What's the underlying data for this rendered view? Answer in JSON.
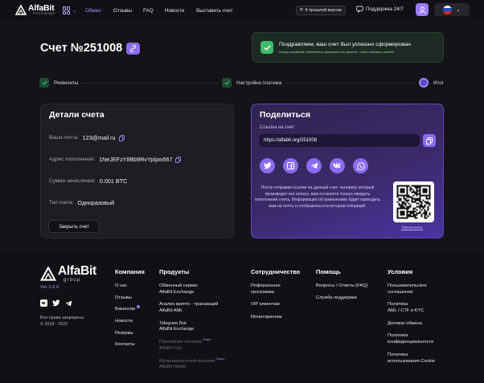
{
  "header": {
    "logo": {
      "title": "AlfaBit",
      "sub": "exchange"
    },
    "nav": [
      "Обмен",
      "Отзывы",
      "FAQ",
      "Новости",
      "Выставить счет"
    ],
    "old_version": "К прошлой версии",
    "support": "Поддержка 24/7",
    "flag_colors": [
      "#ffffff",
      "#1e4ec6",
      "#d52b1e"
    ]
  },
  "page": {
    "title": "Счет №251008"
  },
  "notice": {
    "title": "Поздравляем, ваш счет был успешно сформирован",
    "sub": "Перед отправкой, обязательно проверьте все данные, чтобы избежать ошибок"
  },
  "steps": [
    {
      "label": "Реквизиты",
      "state": "done"
    },
    {
      "label": "Настройка платежа",
      "state": "done"
    },
    {
      "label": "Итог",
      "state": "current"
    }
  ],
  "details": {
    "title": "Детали счета",
    "rows": [
      {
        "label": "Ваша почта:",
        "value": "123@mail.ru"
      },
      {
        "label": "Адрес пополнения:",
        "value": "1NeJEFzY8Bb9RvYpIjav567"
      },
      {
        "label": "Сумма зачисления:",
        "value": "0.001 BTC"
      },
      {
        "label": "Тип счета:",
        "value": "Одноразовый"
      }
    ],
    "close_button": "Закрыть счет"
  },
  "share": {
    "title": "Поделиться",
    "link_label": "Ссылка на счет",
    "link": "https://alfabit.org/251008",
    "socials": [
      {
        "name": "twitter-icon",
        "glyph": "t"
      },
      {
        "name": "facebook-icon",
        "glyph": "f"
      },
      {
        "name": "telegram-icon",
        "glyph": "➤"
      },
      {
        "name": "vk-icon",
        "glyph": "vk"
      },
      {
        "name": "whatsapp-icon",
        "glyph": "✆"
      }
    ],
    "info": "После отправки ссылки на данный счет, человеку который производит его оплату, вам останется только ожидать пополнения счета. Информация об изменениях будет приходить вам на почту и отображаться в истории операций.",
    "enlarge": "Увеличить"
  },
  "footer": {
    "logo": {
      "title": "AlfaBit",
      "sub": "group"
    },
    "version": "Ver 1.0.0",
    "rights": "Все права защищены.",
    "years": "© 2018 - 2022",
    "columns": {
      "company": {
        "title": "Компания",
        "links": [
          "О нас",
          "Отзывы",
          "Вакансии",
          "Новости",
          "Резервы",
          "Контакты"
        ]
      },
      "products": {
        "title": "Продукты",
        "links": [
          {
            "l1": "Обменный сервис",
            "l2": "AlfaBit Exchange"
          },
          {
            "l1": "Анализ крипто - транзакций",
            "l2": "AlfaBit AML"
          },
          {
            "l1": "Telegram Bot",
            "l2": "AlfaBit Exchange"
          },
          {
            "l1": "Платежная система",
            "l2": "AlfaBit Pay",
            "soon": "Скоро"
          },
          {
            "l1": "Мультивалютный кошелек",
            "l2": "AlfaBit Wallet",
            "soon": "Скоро"
          }
        ]
      },
      "cooperation": {
        "title": "Сотрудничество",
        "links": [
          {
            "l1": "Реферальная",
            "l2": "программа"
          },
          {
            "l1": "VIP клиентам"
          },
          {
            "l1": "Мониторингам"
          }
        ]
      },
      "help": {
        "title": "Помощь",
        "links": [
          "Вопросы / Ответы (FAQ)",
          "Служба поддержки"
        ]
      },
      "terms": {
        "title": "Условия",
        "links": [
          {
            "l1": "Пользовательское",
            "l2": "соглашение"
          },
          {
            "l1": "Политика",
            "l2": "AML / CTF и KYC"
          },
          {
            "l1": "Договор обмена"
          },
          {
            "l1": "Политика",
            "l2": "конфиденциальности"
          },
          {
            "l1": "Политика",
            "l2": "использования Cookie"
          }
        ]
      }
    }
  }
}
